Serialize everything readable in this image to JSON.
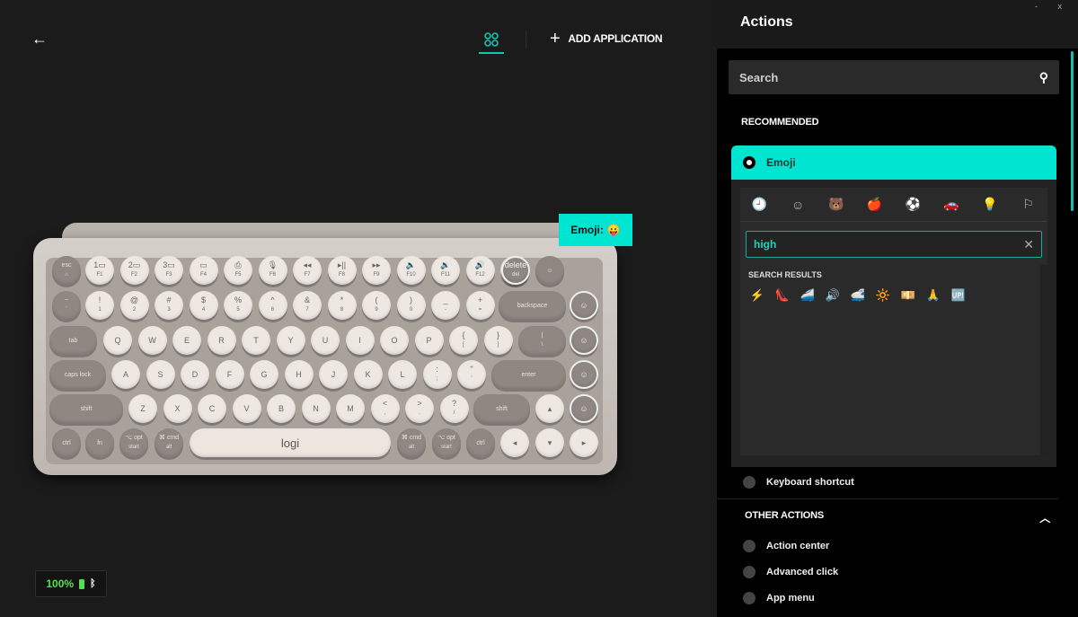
{
  "nav": {
    "back_icon": "arrow-left-icon",
    "apps_icon": "apps-grid-icon",
    "add_application": "ADD APPLICATION",
    "add_icon": "plus-icon"
  },
  "keyboard": {
    "brand": "logi",
    "rows": [
      [
        [
          "esc",
          "⌂"
        ],
        [
          "1▭",
          "F1"
        ],
        [
          "2▭",
          "F2"
        ],
        [
          "3▭",
          "F3"
        ],
        [
          "▭",
          "F4"
        ],
        [
          "⎙",
          "F5"
        ],
        [
          "🎙",
          "F6"
        ],
        [
          "◂◂",
          "F7"
        ],
        [
          "▸||",
          "F8"
        ],
        [
          "▸▸",
          "F9"
        ],
        [
          "🔈",
          "F10"
        ],
        [
          "🔉",
          "F11"
        ],
        [
          "🔊",
          "F12"
        ],
        [
          "☺",
          ""
        ],
        [
          "delete",
          "del"
        ],
        [
          "☺",
          ""
        ]
      ],
      [
        [
          "~",
          "`"
        ],
        [
          "!",
          "1"
        ],
        [
          "@",
          "2"
        ],
        [
          "#",
          "3"
        ],
        [
          "$",
          "4"
        ],
        [
          "%",
          "5"
        ],
        [
          "^",
          "6"
        ],
        [
          "&",
          "7"
        ],
        [
          "*",
          "8"
        ],
        [
          "(",
          "9"
        ],
        [
          ")",
          "0"
        ],
        [
          "_",
          "-"
        ],
        [
          "+",
          "="
        ],
        [
          "backspace",
          ""
        ],
        [
          "☺",
          ""
        ]
      ],
      [
        [
          "tab",
          ""
        ],
        [
          "Q",
          ""
        ],
        [
          "W",
          ""
        ],
        [
          "E",
          ""
        ],
        [
          "R",
          ""
        ],
        [
          "T",
          ""
        ],
        [
          "Y",
          ""
        ],
        [
          "U",
          ""
        ],
        [
          "I",
          ""
        ],
        [
          "O",
          ""
        ],
        [
          "P",
          ""
        ],
        [
          "{",
          "["
        ],
        [
          "}",
          "]"
        ],
        [
          "|",
          "\\"
        ],
        [
          "☺",
          ""
        ]
      ],
      [
        [
          "caps lock",
          ""
        ],
        [
          "A",
          ""
        ],
        [
          "S",
          ""
        ],
        [
          "D",
          ""
        ],
        [
          "F",
          ""
        ],
        [
          "G",
          ""
        ],
        [
          "H",
          ""
        ],
        [
          "J",
          ""
        ],
        [
          "K",
          ""
        ],
        [
          "L",
          ""
        ],
        [
          ":",
          ";"
        ],
        [
          "\"",
          "'"
        ],
        [
          "enter",
          ""
        ],
        [
          "☺",
          ""
        ]
      ],
      [
        [
          "shift",
          ""
        ],
        [
          "Z",
          ""
        ],
        [
          "X",
          ""
        ],
        [
          "C",
          ""
        ],
        [
          "V",
          ""
        ],
        [
          "B",
          ""
        ],
        [
          "N",
          ""
        ],
        [
          "M",
          ""
        ],
        [
          "<",
          ","
        ],
        [
          ">",
          "."
        ],
        [
          "?",
          "/"
        ],
        [
          "shift",
          ""
        ],
        [
          "▴",
          ""
        ],
        [
          "☺",
          ""
        ]
      ],
      [
        [
          "ctrl",
          ""
        ],
        [
          "fn",
          ""
        ],
        [
          "⌥ opt",
          "start"
        ],
        [
          "⌘ cmd",
          "alt"
        ],
        [
          "logi",
          ""
        ],
        [
          "⌘ cmd",
          "alt"
        ],
        [
          "⌥ opt",
          "start"
        ],
        [
          "ctrl",
          ""
        ],
        [
          "◂",
          ""
        ],
        [
          "▾",
          ""
        ],
        [
          "▸",
          ""
        ]
      ]
    ]
  },
  "tooltip": {
    "label": "Emoji:",
    "emoji": "😛"
  },
  "battery": {
    "level": "100%",
    "level_percent": 100,
    "battery_icon": "battery-icon",
    "bluetooth_icon": "bluetooth-icon",
    "color": "#54e04f"
  },
  "panel": {
    "title": "Actions",
    "window_controls": "- x",
    "search": {
      "placeholder": "Search",
      "icon": "search-icon"
    },
    "recommended_label": "RECOMMENDED",
    "emoji": {
      "label": "Emoji",
      "accent": "#00e5d1",
      "categories": [
        "🕘",
        "☺",
        "🐻",
        "🍎",
        "⚽",
        "🚗",
        "💡",
        "⚐"
      ],
      "query": "high",
      "results_label": "SEARCH RESULTS",
      "results": [
        "⚡",
        "👠",
        "🚄",
        "🔊",
        "🚅",
        "🔆",
        "💴",
        "🙏",
        "🆙"
      ]
    },
    "keyboard_shortcut": "Keyboard shortcut",
    "other_actions_label": "OTHER ACTIONS",
    "other_actions": [
      "Action center",
      "Advanced click",
      "App menu"
    ]
  }
}
